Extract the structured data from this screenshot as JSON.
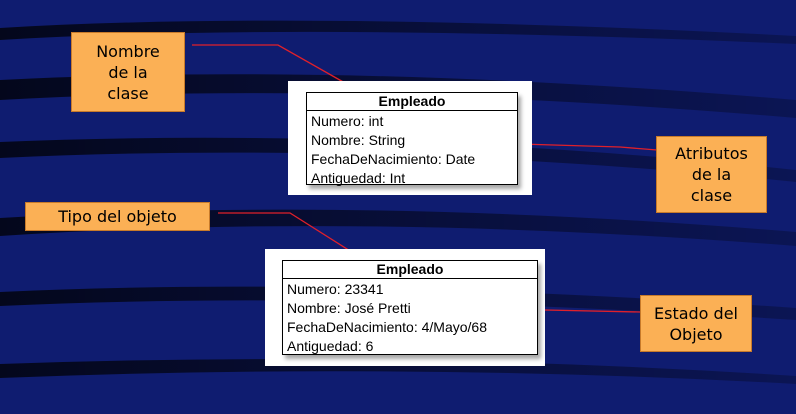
{
  "colors": {
    "background": "#0f1c70",
    "callout_fill": "#fbb055",
    "connector": "#e0202a"
  },
  "callouts": {
    "class_name": [
      "Nombre",
      "de la",
      "clase"
    ],
    "object_type": [
      "Tipo del objeto"
    ],
    "class_attributes": [
      "Atributos",
      "de la",
      "clase"
    ],
    "object_state": [
      "Estado del",
      "Objeto"
    ]
  },
  "class_box": {
    "title": "Empleado",
    "attributes": [
      "Numero: int",
      "Nombre: String",
      "FechaDeNacimiento: Date",
      "Antiguedad: Int"
    ]
  },
  "object_box": {
    "title": "Empleado",
    "attributes": [
      "Numero: 23341",
      "Nombre: José Pretti",
      "FechaDeNacimiento: 4/Mayo/68",
      "Antiguedad: 6"
    ]
  }
}
